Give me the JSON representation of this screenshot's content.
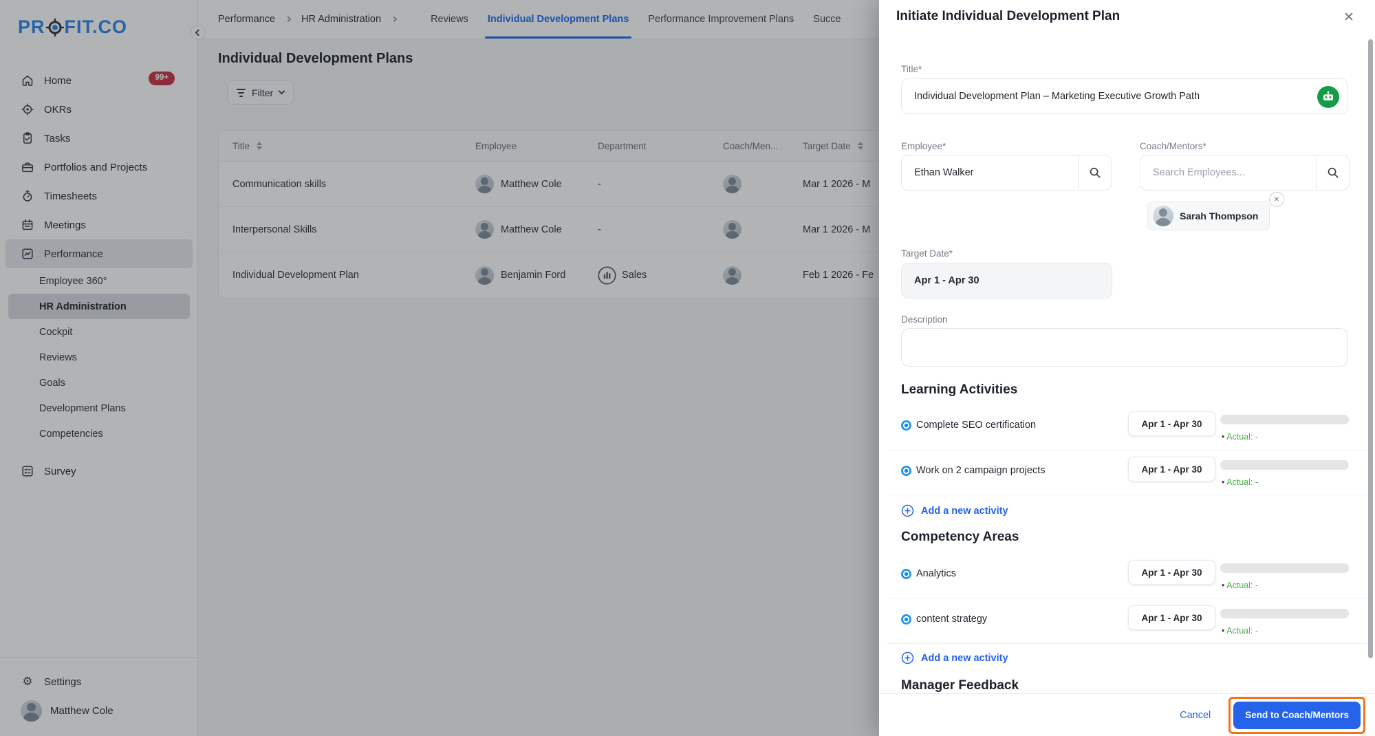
{
  "brand": {
    "logo_left": "PR",
    "logo_right": "FIT.CO"
  },
  "sidebar": {
    "items": [
      {
        "label": "Home",
        "badge": "99+"
      },
      {
        "label": "OKRs"
      },
      {
        "label": "Tasks"
      },
      {
        "label": "Portfolios and Projects"
      },
      {
        "label": "Timesheets"
      },
      {
        "label": "Meetings"
      },
      {
        "label": "Performance"
      }
    ],
    "performance_children": [
      {
        "label": "Employee 360°"
      },
      {
        "label": "HR Administration"
      },
      {
        "label": "Cockpit"
      },
      {
        "label": "Reviews"
      },
      {
        "label": "Goals"
      },
      {
        "label": "Development Plans"
      },
      {
        "label": "Competencies"
      }
    ],
    "survey_label": "Survey",
    "settings_label": "Settings",
    "user_name": "Matthew Cole"
  },
  "header": {
    "breadcrumbs": [
      "Performance",
      "HR Administration"
    ],
    "tabs": [
      {
        "label": "Reviews"
      },
      {
        "label": "Individual Development Plans"
      },
      {
        "label": "Performance Improvement Plans"
      },
      {
        "label": "Succe"
      }
    ]
  },
  "page": {
    "title": "Individual Development Plans",
    "filter_label": "Filter"
  },
  "table": {
    "columns": {
      "title": "Title",
      "employee": "Employee",
      "department": "Department",
      "coach": "Coach/Men...",
      "target_date": "Target Date"
    },
    "rows": [
      {
        "title": "Communication skills",
        "employee": "Matthew Cole",
        "department": "-",
        "target_date": "Mar 1 2026 - M"
      },
      {
        "title": "Interpersonal Skills",
        "employee": "Matthew Cole",
        "department": "-",
        "target_date": "Mar 1 2026 - M"
      },
      {
        "title": "Individual Development Plan",
        "employee": "Benjamin Ford",
        "department": "Sales",
        "target_date": "Feb 1 2026 - Fe"
      }
    ]
  },
  "drawer": {
    "title": "Initiate Individual Development Plan",
    "title_field": {
      "label": "Title*",
      "value": "Individual Development Plan – Marketing Executive Growth Path"
    },
    "employee_field": {
      "label": "Employee*",
      "value": "Ethan  Walker"
    },
    "coach_field": {
      "label": "Coach/Mentors*",
      "placeholder": "Search Employees...",
      "chip": "Sarah Thompson"
    },
    "target_date_field": {
      "label": "Target Date*",
      "value": "Apr 1 - Apr 30"
    },
    "description_field": {
      "label": "Description"
    },
    "learning": {
      "heading": "Learning Activities",
      "items": [
        {
          "name": "Complete SEO certification",
          "date": "Apr 1 - Apr 30",
          "actual": "Actual: -"
        },
        {
          "name": "Work on 2 campaign projects",
          "date": "Apr 1 - Apr 30",
          "actual": "Actual: -"
        }
      ],
      "add_label": "Add a new activity"
    },
    "competency": {
      "heading": "Competency Areas",
      "items": [
        {
          "name": "Analytics",
          "date": "Apr 1 - Apr 30",
          "actual": "Actual: -"
        },
        {
          "name": "content strategy",
          "date": "Apr 1 - Apr 30",
          "actual": "Actual: -"
        }
      ],
      "add_label": "Add a new activity"
    },
    "feedback_heading": "Manager Feedback",
    "footer": {
      "cancel": "Cancel",
      "submit": "Send to Coach/Mentors"
    }
  },
  "colors": {
    "accent_blue": "#1b6ff2",
    "brand_blue": "#2b87e8",
    "badge_red": "#ca3248",
    "actual_green": "#4caf50",
    "ai_icon_green": "#169b47",
    "highlight_orange": "#f2711c"
  }
}
